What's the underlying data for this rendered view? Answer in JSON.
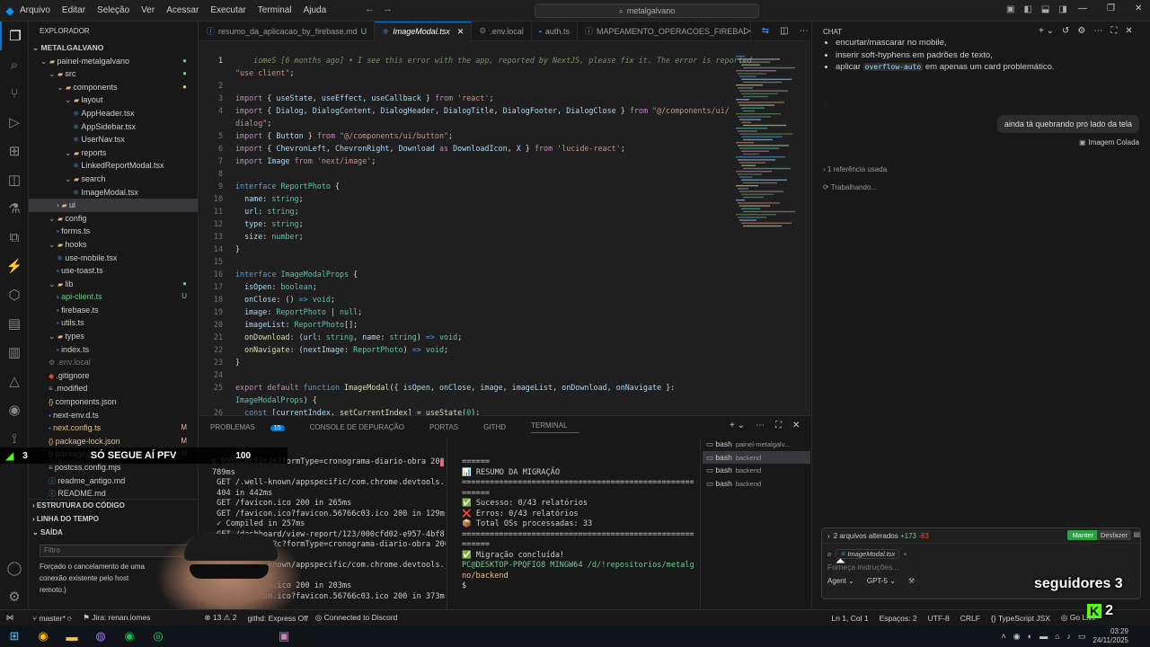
{
  "titlebar": {
    "menu": [
      "Arquivo",
      "Editar",
      "Seleção",
      "Ver",
      "Acessar",
      "Executar",
      "Terminal",
      "Ajuda"
    ],
    "search": "metalgalvano"
  },
  "explorer": {
    "header": "EXPLORADOR",
    "root": "METALGALVANO",
    "items": [
      {
        "label": "painel-metalgalvano",
        "indent": 1,
        "kind": "folder",
        "open": true,
        "badge": "●",
        "badge_color": "#73c991"
      },
      {
        "label": "src",
        "indent": 2,
        "kind": "folder",
        "open": true,
        "badge": "●",
        "badge_color": "#73c991"
      },
      {
        "label": "components",
        "indent": 3,
        "kind": "folder",
        "open": true,
        "badge": "●",
        "badge_color": "#e2c08d"
      },
      {
        "label": "layout",
        "indent": 4,
        "kind": "folder",
        "open": true,
        "badge": "",
        "badge_color": ""
      },
      {
        "label": "AppHeader.tsx",
        "indent": 5,
        "kind": "tsx",
        "badge": "",
        "badge_color": ""
      },
      {
        "label": "AppSidebar.tsx",
        "indent": 5,
        "kind": "tsx",
        "badge": "",
        "badge_color": ""
      },
      {
        "label": "UserNav.tsx",
        "indent": 5,
        "kind": "tsx",
        "badge": "",
        "badge_color": ""
      },
      {
        "label": "reports",
        "indent": 4,
        "kind": "folder",
        "open": true,
        "badge": "",
        "badge_color": ""
      },
      {
        "label": "LinkedReportModal.tsx",
        "indent": 5,
        "kind": "tsx",
        "badge": "",
        "badge_color": ""
      },
      {
        "label": "search",
        "indent": 4,
        "kind": "folder",
        "open": true,
        "badge": "",
        "badge_color": ""
      },
      {
        "label": "ImageModal.tsx",
        "indent": 5,
        "kind": "tsx",
        "badge": "",
        "badge_color": ""
      },
      {
        "label": "ui",
        "indent": 3,
        "kind": "folder",
        "open": false,
        "badge": "",
        "badge_color": "",
        "selected": true
      },
      {
        "label": "config",
        "indent": 2,
        "kind": "folder",
        "open": true,
        "badge": "",
        "badge_color": ""
      },
      {
        "label": "forms.ts",
        "indent": 3,
        "kind": "ts",
        "badge": "",
        "badge_color": ""
      },
      {
        "label": "hooks",
        "indent": 2,
        "kind": "folder",
        "open": true,
        "badge": "",
        "badge_color": ""
      },
      {
        "label": "use-mobile.tsx",
        "indent": 3,
        "kind": "tsx",
        "badge": "",
        "badge_color": ""
      },
      {
        "label": "use-toast.ts",
        "indent": 3,
        "kind": "ts",
        "badge": "",
        "badge_color": ""
      },
      {
        "label": "lib",
        "indent": 2,
        "kind": "folder",
        "open": true,
        "badge": "●",
        "badge_color": "#73c991"
      },
      {
        "label": "api-client.ts",
        "indent": 3,
        "kind": "ts",
        "badge": "U",
        "badge_color": "#73c991",
        "color": "#73c991"
      },
      {
        "label": "firebase.ts",
        "indent": 3,
        "kind": "ts",
        "badge": "",
        "badge_color": ""
      },
      {
        "label": "utils.ts",
        "indent": 3,
        "kind": "ts",
        "badge": "",
        "badge_color": ""
      },
      {
        "label": "types",
        "indent": 2,
        "kind": "folder",
        "open": true,
        "badge": "",
        "badge_color": ""
      },
      {
        "label": "index.ts",
        "indent": 3,
        "kind": "ts",
        "badge": "",
        "badge_color": ""
      },
      {
        "label": ".env.local",
        "indent": 2,
        "kind": "env",
        "badge": "",
        "badge_color": "",
        "color": "#6e7681"
      },
      {
        "label": ".gitignore",
        "indent": 2,
        "kind": "git",
        "badge": "",
        "badge_color": ""
      },
      {
        "label": ".modified",
        "indent": 2,
        "kind": "file",
        "badge": "",
        "badge_color": ""
      },
      {
        "label": "components.json",
        "indent": 2,
        "kind": "json",
        "badge": "",
        "badge_color": ""
      },
      {
        "label": "next-env.d.ts",
        "indent": 2,
        "kind": "ts",
        "badge": "",
        "badge_color": ""
      },
      {
        "label": "next.config.ts",
        "indent": 2,
        "kind": "ts",
        "badge": "M",
        "badge_color": "#e2c08d",
        "color": "#e2c08d"
      },
      {
        "label": "package-lock.json",
        "indent": 2,
        "kind": "json",
        "badge": "M",
        "badge_color": "#e2c08d",
        "color": "#e2c08d"
      },
      {
        "label": "package.json",
        "indent": 2,
        "kind": "json",
        "badge": "M",
        "badge_color": "#e2c08d",
        "color": "#e2c08d"
      },
      {
        "label": "postcss.config.mjs",
        "indent": 2,
        "kind": "file",
        "badge": "",
        "badge_color": ""
      },
      {
        "label": "readme_antigo.md",
        "indent": 2,
        "kind": "md",
        "badge": "",
        "badge_color": ""
      },
      {
        "label": "README.md",
        "indent": 2,
        "kind": "md",
        "badge": "",
        "badge_color": ""
      }
    ],
    "sections": [
      "ESTRUTURA DO CÓDIGO",
      "LINHA DO TEMPO",
      "SAÍDA"
    ],
    "output_filter": "Filtro",
    "output_text": [
      "Forçado o cancelamento de uma",
      "conexão existente pelo host",
      "remoto.)"
    ]
  },
  "editor": {
    "tabs": [
      {
        "label": "resumo_da_aplicacao_by_firebase.md",
        "suffix": "U",
        "active": false
      },
      {
        "label": "ImageModal.tsx",
        "suffix": "",
        "active": true
      },
      {
        "label": ".env.local",
        "suffix": "",
        "active": false
      },
      {
        "label": "auth.ts",
        "suffix": "",
        "active": false
      },
      {
        "label": "MAPEAMENTO_OPERACOES_FIREBA",
        "suffix": "",
        "active": false
      }
    ],
    "lines": [
      {
        "n": "1",
        "t": "<span class=\"cm\">    iomeS [6 months ago] • I see this error with the app, reported by NextJS, please fix it. The error is reported</span>"
      },
      {
        "n": "",
        "t": "<span class=\"str\">\"use client\"</span>;"
      },
      {
        "n": "2",
        "t": ""
      },
      {
        "n": "3",
        "t": "<span class=\"kw2\">import</span> { <span class=\"vr\">useState</span>, <span class=\"vr\">useEffect</span>, <span class=\"vr\">useCallback</span> } <span class=\"kw2\">from</span> <span class=\"str\">'react'</span>;"
      },
      {
        "n": "4",
        "t": "<span class=\"kw2\">import</span> { <span class=\"vr\">Dialog</span>, <span class=\"vr\">DialogContent</span>, <span class=\"vr\">DialogHeader</span>, <span class=\"vr\">DialogTitle</span>, <span class=\"vr\">DialogFooter</span>, <span class=\"vr\">DialogClose</span> } <span class=\"kw2\">from</span> <span class=\"str\">\"@/components/ui/</span>"
      },
      {
        "n": "",
        "t": "<span class=\"str\">dialog\"</span>;"
      },
      {
        "n": "5",
        "t": "<span class=\"kw2\">import</span> { <span class=\"vr\">Button</span> } <span class=\"kw2\">from</span> <span class=\"str\">\"@/components/ui/button\"</span>;"
      },
      {
        "n": "6",
        "t": "<span class=\"kw2\">import</span> { <span class=\"vr\">ChevronLeft</span>, <span class=\"vr\">ChevronRight</span>, <span class=\"vr\">Download</span> <span class=\"kw2\">as</span> <span class=\"vr\">DownloadIcon</span>, <span class=\"vr\">X</span> } <span class=\"kw2\">from</span> <span class=\"str\">'lucide-react'</span>;"
      },
      {
        "n": "7",
        "t": "<span class=\"kw2\">import</span> <span class=\"vr\">Image</span> <span class=\"kw2\">from</span> <span class=\"str\">'next/image'</span>;"
      },
      {
        "n": "8",
        "t": ""
      },
      {
        "n": "9",
        "t": "<span class=\"kw\">interface</span> <span class=\"ty\">ReportPhoto</span> {"
      },
      {
        "n": "10",
        "t": "  <span class=\"vr\">name</span>: <span class=\"ty\">string</span>;"
      },
      {
        "n": "11",
        "t": "  <span class=\"vr\">url</span>: <span class=\"ty\">string</span>;"
      },
      {
        "n": "12",
        "t": "  <span class=\"vr\">type</span>: <span class=\"ty\">string</span>;"
      },
      {
        "n": "13",
        "t": "  <span class=\"vr\">size</span>: <span class=\"ty\">number</span>;"
      },
      {
        "n": "14",
        "t": "}"
      },
      {
        "n": "15",
        "t": ""
      },
      {
        "n": "16",
        "t": "<span class=\"kw\">interface</span> <span class=\"ty\">ImageModalProps</span> {"
      },
      {
        "n": "17",
        "t": "  <span class=\"vr\">isOpen</span>: <span class=\"ty\">boolean</span>;"
      },
      {
        "n": "18",
        "t": "  <span class=\"vr\">onClose</span>: () <span class=\"kw\">=></span> <span class=\"ty\">void</span>;"
      },
      {
        "n": "19",
        "t": "  <span class=\"vr\">image</span>: <span class=\"ty\">ReportPhoto</span> | <span class=\"ty\">null</span>;"
      },
      {
        "n": "20",
        "t": "  <span class=\"vr\">imageList</span>: <span class=\"ty\">ReportPhoto</span>[];"
      },
      {
        "n": "21",
        "t": "  <span class=\"fn\">onDownload</span>: (<span class=\"vr\">url</span>: <span class=\"ty\">string</span>, <span class=\"vr\">name</span>: <span class=\"ty\">string</span>) <span class=\"kw\">=></span> <span class=\"ty\">void</span>;"
      },
      {
        "n": "22",
        "t": "  <span class=\"fn\">onNavigate</span>: (<span class=\"vr\">nextImage</span>: <span class=\"ty\">ReportPhoto</span>) <span class=\"kw\">=></span> <span class=\"ty\">void</span>;"
      },
      {
        "n": "23",
        "t": "}"
      },
      {
        "n": "24",
        "t": ""
      },
      {
        "n": "25",
        "t": "<span class=\"kw2\">export</span> <span class=\"kw2\">default</span> <span class=\"kw\">function</span> <span class=\"fn\">ImageModal</span>({ <span class=\"vr\">isOpen</span>, <span class=\"vr\">onClose</span>, <span class=\"vr\">image</span>, <span class=\"vr\">imageList</span>, <span class=\"vr\">onDownload</span>, <span class=\"vr\">onNavigate</span> }:"
      },
      {
        "n": "",
        "t": "<span class=\"ty\">ImageModalProps</span>) {"
      },
      {
        "n": "26",
        "t": "  <span class=\"kw\">const</span> [<span class=\"vr\">currentIndex</span>, <span class=\"fn\">setCurrentIndex</span>] = <span class=\"fn\">useState</span>(<span class=\"ty\">0</span>);"
      }
    ]
  },
  "panel": {
    "tabs": [
      "PROBLEMAS",
      "CONSOLE DE DEPURAÇÃO",
      "PORTAS",
      "GITHD",
      "TERMINAL"
    ],
    "problems_count": "15",
    "left_term": [
      "c 09bab6c52c2c?formType=cronograma-diario-obra 200 in",
      "789ms",
      " GET /.well-known/appspecific/com.chrome.devtools.json",
      " 404 in 442ms",
      " GET /favicon.ico 200 in 265ms",
      " GET /favicon.ico?favicon.56766c03.ico 200 in 129ms",
      " ✓ Compiled in 257ms",
      " GET /dashboard/view-report/123/000cfd02-e957-4bf8-a66",
      " c 09bab6c52c2c?formType=cronograma-diario-obra 200 in",
      " 789ms",
      " GET /.well-known/appspecific/com.chrome.devtools.json",
      " 404 in 442ms",
      " GET /favicon.ico 200 in 203ms",
      " GET /favicon.ico?favicon.56766c03.ico 200 in 373ms"
    ],
    "right_term": [
      "======",
      "📊 RESUMO DA MIGRAÇÃO",
      "=========================================================",
      "======",
      "✅ Sucesso: 0/43 relatórios",
      "❌ Erros: 0/43 relatórios",
      "📦 Total OSs processadas: 33",
      "=========================================================",
      "======",
      "",
      "✅ Migração concluída!",
      "",
      "PC@DESKTOP-PPQFIO8 MINGW64 /d/!repositorios/metalgalva",
      "no/backend",
      "$ "
    ],
    "terminals": [
      {
        "label": "bash",
        "sub": "painel-metalgalv..."
      },
      {
        "label": "bash",
        "sub": "backend",
        "active": true
      },
      {
        "label": "bash",
        "sub": "backend"
      },
      {
        "label": "bash",
        "sub": "backend"
      }
    ]
  },
  "chat": {
    "title": "CHAT",
    "bullets": [
      "encurtar/mascarar no mobile,",
      "inserir soft-hyphens em padrões de texto,",
      "aplicar overflow-auto em apenas um card problemático."
    ],
    "inline_code": "overflow-auto",
    "user_message": "ainda tá quebrando pro lado da tela",
    "attachment": "Imagem Colada",
    "ref": "1 referência usada",
    "working": "Trabalhando...",
    "changes": "2 arquivos alterados",
    "added": "+173",
    "removed": "-83",
    "keep": "Manter",
    "undo": "Desfazer",
    "context_file": "ImageModal.tsx",
    "input_placeholder": "Forneça instruções...",
    "mode": "Agent",
    "model": "GPT-5"
  },
  "statusbar": {
    "branch": "master*",
    "jira": "Jira: renan.iomes",
    "issues": "13",
    "warnings": "2",
    "githd": "githd: Express Off",
    "discord": "Connected to Discord",
    "position": "Ln 1, Col 1",
    "spaces": "Espaços: 2",
    "encoding": "UTF-8",
    "eol": "CRLF",
    "lang": "TypeScript JSX",
    "golive": "Go Live"
  },
  "overlay": {
    "left_num": "3",
    "left_text": "SÓ SEGUE AÍ PFV",
    "goal": "100",
    "followers": "seguidores 3",
    "kick_num": "2"
  },
  "taskbar": {
    "time": "03:29",
    "date": "24/11/2025"
  }
}
